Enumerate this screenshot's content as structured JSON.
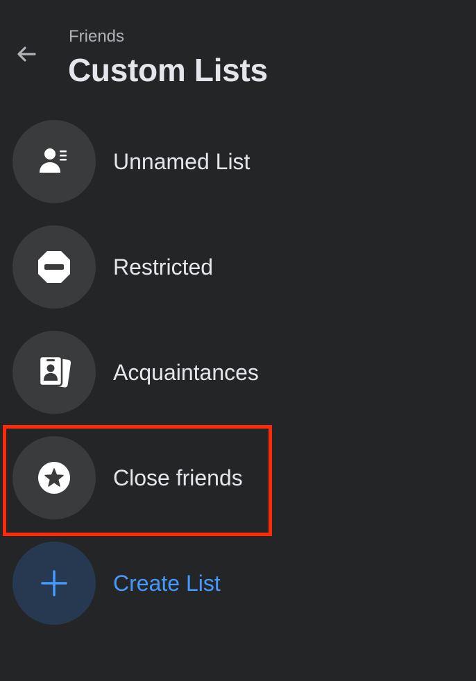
{
  "header": {
    "breadcrumb": "Friends",
    "title": "Custom Lists"
  },
  "lists": [
    {
      "label": "Unnamed List",
      "icon": "person-list-icon"
    },
    {
      "label": "Restricted",
      "icon": "restricted-icon"
    },
    {
      "label": "Acquaintances",
      "icon": "acquaintances-icon"
    },
    {
      "label": "Close friends",
      "icon": "star-icon"
    }
  ],
  "create": {
    "label": "Create List",
    "icon": "plus-icon"
  },
  "colors": {
    "background": "#242526",
    "circle": "#3a3b3c",
    "create_circle": "#263951",
    "accent": "#4599ff",
    "highlight": "#ff2a0a"
  },
  "highlighted_item": "Close friends"
}
